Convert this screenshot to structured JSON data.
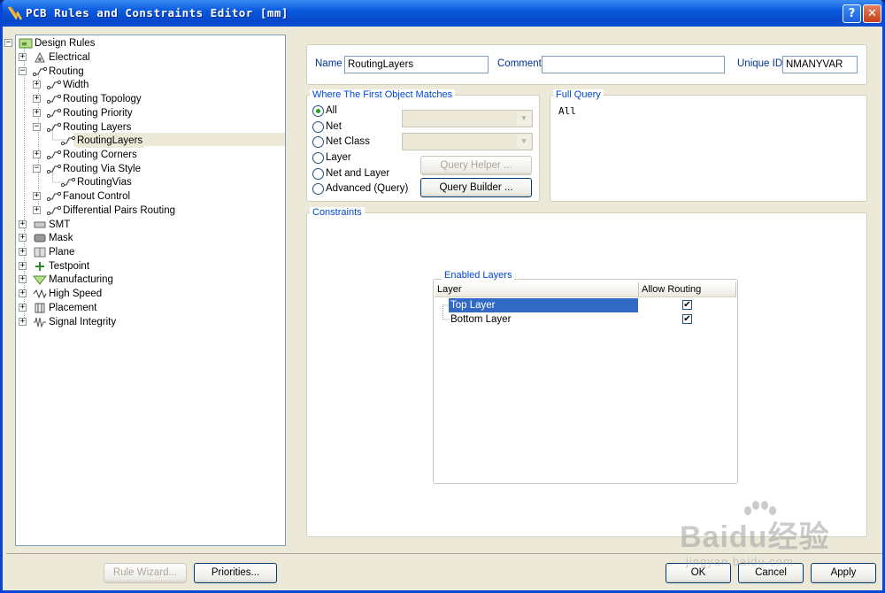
{
  "window": {
    "title": "PCB Rules and Constraints Editor [mm]",
    "help_glyph": "?",
    "close_glyph": "✕"
  },
  "tree": {
    "items": [
      {
        "label": "Design Rules",
        "icon": "design-rules-icon"
      },
      {
        "label": "Electrical",
        "icon": "electrical-icon"
      },
      {
        "label": "Routing",
        "icon": "routing-icon"
      },
      {
        "label": "Width",
        "icon": "rule-icon"
      },
      {
        "label": "Routing Topology",
        "icon": "rule-icon"
      },
      {
        "label": "Routing Priority",
        "icon": "rule-icon"
      },
      {
        "label": "Routing Layers",
        "icon": "rule-icon"
      },
      {
        "label": "RoutingLayers",
        "icon": "rule-icon"
      },
      {
        "label": "Routing Corners",
        "icon": "rule-icon"
      },
      {
        "label": "Routing Via Style",
        "icon": "rule-icon"
      },
      {
        "label": "RoutingVias",
        "icon": "rule-icon"
      },
      {
        "label": "Fanout Control",
        "icon": "rule-icon"
      },
      {
        "label": "Differential Pairs Routing",
        "icon": "rule-icon"
      },
      {
        "label": "SMT",
        "icon": "smt-icon"
      },
      {
        "label": "Mask",
        "icon": "mask-icon"
      },
      {
        "label": "Plane",
        "icon": "plane-icon"
      },
      {
        "label": "Testpoint",
        "icon": "testpoint-icon"
      },
      {
        "label": "Manufacturing",
        "icon": "manufacturing-icon"
      },
      {
        "label": "High Speed",
        "icon": "high-speed-icon"
      },
      {
        "label": "Placement",
        "icon": "placement-icon"
      },
      {
        "label": "Signal Integrity",
        "icon": "signal-integrity-icon"
      }
    ]
  },
  "rule": {
    "name_label": "Name",
    "name_value": "RoutingLayers",
    "comment_label": "Comment",
    "comment_value": "",
    "uid_label": "Unique ID",
    "uid_value": "NMANYVAR"
  },
  "match": {
    "title": "Where The First Object Matches",
    "options": [
      "All",
      "Net",
      "Net Class",
      "Layer",
      "Net and Layer",
      "Advanced (Query)"
    ],
    "selected": "All",
    "query_helper": "Query Helper ...",
    "query_builder": "Query Builder ..."
  },
  "full_query": {
    "title": "Full Query",
    "text": "All"
  },
  "constraints": {
    "title": "Constraints",
    "enabled_layers_title": "Enabled Layers",
    "columns": [
      "Layer",
      "Allow Routing"
    ],
    "rows": [
      {
        "layer": "Top Layer",
        "allow": "✔"
      },
      {
        "layer": "Bottom Layer",
        "allow": "✔"
      }
    ]
  },
  "footer": {
    "rule_wizard": "Rule Wizard...",
    "priorities": "Priorities...",
    "ok": "OK",
    "cancel": "Cancel",
    "apply": "Apply"
  },
  "watermark": {
    "brand": "Baidu经验",
    "url": "jingyan.baidu.com"
  },
  "colors": {
    "titlebar": "#0a5ae0",
    "selection": "#316ac5",
    "group_title": "#0046d5"
  }
}
